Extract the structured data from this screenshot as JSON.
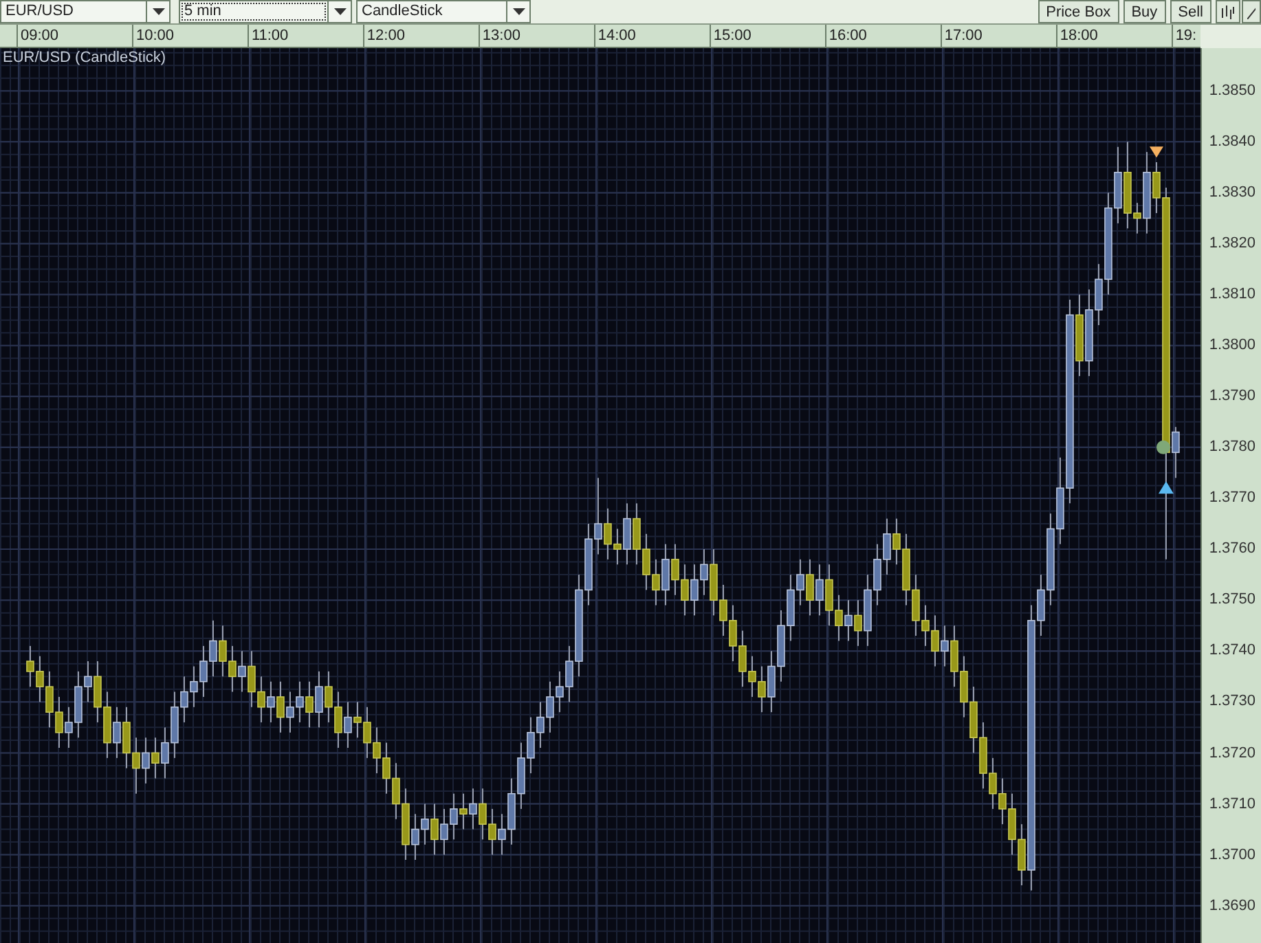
{
  "toolbar": {
    "symbol": "EUR/USD",
    "timeframe": "5 min",
    "chart_type": "CandleStick",
    "buttons": [
      "Price Box",
      "Buy",
      "Sell"
    ]
  },
  "chart": {
    "chart_data": {
      "type": "candlestick",
      "title": "EUR/USD (CandleStick)",
      "grid": true,
      "xlim": [
        8.655,
        19.048
      ],
      "ylim": [
        1.36824,
        1.38584
      ],
      "x": [
        8.9167,
        9,
        9.0833,
        9.1667,
        9.25,
        9.3333,
        9.4167,
        9.5,
        9.5833,
        9.6667,
        9.75,
        9.8333,
        9.9167,
        10,
        10.0833,
        10.1667,
        10.25,
        10.3333,
        10.4167,
        10.5,
        10.5833,
        10.6667,
        10.75,
        10.8333,
        10.9167,
        11,
        11.0833,
        11.1667,
        11.25,
        11.3333,
        11.4167,
        11.5,
        11.5833,
        11.6667,
        11.75,
        11.8333,
        11.9167,
        12,
        12.0833,
        12.1667,
        12.25,
        12.3333,
        12.4167,
        12.5,
        12.5833,
        12.6667,
        12.75,
        12.8333,
        12.9167,
        13,
        13.0833,
        13.1667,
        13.25,
        13.3333,
        13.4167,
        13.5,
        13.5833,
        13.6667,
        13.75,
        13.8333,
        13.9167,
        14,
        14.0833,
        14.1667,
        14.25,
        14.3333,
        14.4167,
        14.5,
        14.5833,
        14.6667,
        14.75,
        14.8333,
        14.9167,
        15,
        15.0833,
        15.1667,
        15.25,
        15.3333,
        15.4167,
        15.5,
        15.5833,
        15.6667,
        15.75,
        15.8333,
        15.9167,
        16,
        16.0833,
        16.1667,
        16.25,
        16.3333,
        16.4167,
        16.5,
        16.5833,
        16.6667,
        16.75,
        16.8333,
        16.9167,
        17,
        17.0833,
        17.1667,
        17.25,
        17.3333,
        17.4167,
        17.5,
        17.5833,
        17.6667,
        17.75,
        17.8333,
        17.9167,
        18,
        18.0833,
        18.1667,
        18.25,
        18.3333,
        18.4167,
        18.5,
        18.5833,
        18.6667,
        18.75,
        18.8333
      ],
      "ohlc": [
        [
          1.3738,
          1.3741,
          1.3733,
          1.3736
        ],
        [
          1.3736,
          1.3739,
          1.373,
          1.3733
        ],
        [
          1.3733,
          1.3736,
          1.3725,
          1.3728
        ],
        [
          1.3728,
          1.3731,
          1.3721,
          1.3724
        ],
        [
          1.3724,
          1.3729,
          1.3721,
          1.3726
        ],
        [
          1.3726,
          1.3736,
          1.3723,
          1.3733
        ],
        [
          1.3733,
          1.3738,
          1.373,
          1.3735
        ],
        [
          1.3735,
          1.3738,
          1.3726,
          1.3729
        ],
        [
          1.3729,
          1.3732,
          1.3719,
          1.3722
        ],
        [
          1.3722,
          1.3729,
          1.3719,
          1.3726
        ],
        [
          1.3726,
          1.3729,
          1.3717,
          1.372
        ],
        [
          1.372,
          1.3723,
          1.3712,
          1.3717
        ],
        [
          1.3717,
          1.3723,
          1.3714,
          1.372
        ],
        [
          1.372,
          1.3723,
          1.3715,
          1.3718
        ],
        [
          1.3718,
          1.3725,
          1.3715,
          1.3722
        ],
        [
          1.3722,
          1.3732,
          1.3719,
          1.3729
        ],
        [
          1.3729,
          1.3735,
          1.3726,
          1.3732
        ],
        [
          1.3732,
          1.3737,
          1.3729,
          1.3734
        ],
        [
          1.3734,
          1.3741,
          1.3731,
          1.3738
        ],
        [
          1.3738,
          1.3746,
          1.3735,
          1.3742
        ],
        [
          1.3742,
          1.3745,
          1.3735,
          1.3738
        ],
        [
          1.3738,
          1.3741,
          1.3732,
          1.3735
        ],
        [
          1.3735,
          1.374,
          1.3732,
          1.3737
        ],
        [
          1.3737,
          1.374,
          1.3729,
          1.3732
        ],
        [
          1.3732,
          1.3735,
          1.3726,
          1.3729
        ],
        [
          1.3729,
          1.3734,
          1.3726,
          1.3731
        ],
        [
          1.3731,
          1.3734,
          1.3724,
          1.3727
        ],
        [
          1.3727,
          1.3732,
          1.3724,
          1.3729
        ],
        [
          1.3729,
          1.3734,
          1.3726,
          1.3731
        ],
        [
          1.3731,
          1.3734,
          1.3725,
          1.3728
        ],
        [
          1.3728,
          1.3736,
          1.3725,
          1.3733
        ],
        [
          1.3733,
          1.3736,
          1.3726,
          1.3729
        ],
        [
          1.3729,
          1.3732,
          1.3721,
          1.3724
        ],
        [
          1.3724,
          1.373,
          1.3721,
          1.3727
        ],
        [
          1.3727,
          1.373,
          1.3723,
          1.3726
        ],
        [
          1.3726,
          1.3729,
          1.3719,
          1.3722
        ],
        [
          1.3722,
          1.3725,
          1.3716,
          1.3719
        ],
        [
          1.3719,
          1.3722,
          1.3712,
          1.3715
        ],
        [
          1.3715,
          1.3718,
          1.3707,
          1.371
        ],
        [
          1.371,
          1.3713,
          1.3699,
          1.3702
        ],
        [
          1.3702,
          1.3708,
          1.3699,
          1.3705
        ],
        [
          1.3705,
          1.371,
          1.3702,
          1.3707
        ],
        [
          1.3707,
          1.371,
          1.37,
          1.3703
        ],
        [
          1.3703,
          1.3709,
          1.37,
          1.3706
        ],
        [
          1.3706,
          1.3712,
          1.3703,
          1.3709
        ],
        [
          1.3709,
          1.3712,
          1.3705,
          1.3708
        ],
        [
          1.3708,
          1.3713,
          1.3705,
          1.371
        ],
        [
          1.371,
          1.3713,
          1.3703,
          1.3706
        ],
        [
          1.3706,
          1.3709,
          1.37,
          1.3703
        ],
        [
          1.3703,
          1.3708,
          1.37,
          1.3705
        ],
        [
          1.3705,
          1.3715,
          1.3702,
          1.3712
        ],
        [
          1.3712,
          1.3722,
          1.3709,
          1.3719
        ],
        [
          1.3719,
          1.3727,
          1.3716,
          1.3724
        ],
        [
          1.3724,
          1.373,
          1.3721,
          1.3727
        ],
        [
          1.3727,
          1.3734,
          1.3724,
          1.3731
        ],
        [
          1.3731,
          1.3736,
          1.3728,
          1.3733
        ],
        [
          1.3733,
          1.3741,
          1.373,
          1.3738
        ],
        [
          1.3738,
          1.3755,
          1.3735,
          1.3752
        ],
        [
          1.3752,
          1.3765,
          1.3749,
          1.3762
        ],
        [
          1.3762,
          1.3774,
          1.3759,
          1.3765
        ],
        [
          1.3765,
          1.3768,
          1.3758,
          1.3761
        ],
        [
          1.3761,
          1.3764,
          1.3757,
          1.376
        ],
        [
          1.376,
          1.3769,
          1.3757,
          1.3766
        ],
        [
          1.3766,
          1.3769,
          1.3757,
          1.376
        ],
        [
          1.376,
          1.3763,
          1.3752,
          1.3755
        ],
        [
          1.3755,
          1.3758,
          1.3749,
          1.3752
        ],
        [
          1.3752,
          1.3761,
          1.3749,
          1.3758
        ],
        [
          1.3758,
          1.3761,
          1.3751,
          1.3754
        ],
        [
          1.3754,
          1.3757,
          1.3747,
          1.375
        ],
        [
          1.375,
          1.3757,
          1.3747,
          1.3754
        ],
        [
          1.3754,
          1.376,
          1.3751,
          1.3757
        ],
        [
          1.3757,
          1.376,
          1.3747,
          1.375
        ],
        [
          1.375,
          1.3753,
          1.3743,
          1.3746
        ],
        [
          1.3746,
          1.3749,
          1.3738,
          1.3741
        ],
        [
          1.3741,
          1.3744,
          1.3733,
          1.3736
        ],
        [
          1.3736,
          1.3739,
          1.3731,
          1.3734
        ],
        [
          1.3734,
          1.3737,
          1.3728,
          1.3731
        ],
        [
          1.3731,
          1.374,
          1.3728,
          1.3737
        ],
        [
          1.3737,
          1.3748,
          1.3734,
          1.3745
        ],
        [
          1.3745,
          1.3755,
          1.3742,
          1.3752
        ],
        [
          1.3752,
          1.3758,
          1.3749,
          1.3755
        ],
        [
          1.3755,
          1.3758,
          1.3747,
          1.375
        ],
        [
          1.375,
          1.3757,
          1.3747,
          1.3754
        ],
        [
          1.3754,
          1.3757,
          1.3745,
          1.3748
        ],
        [
          1.3748,
          1.3751,
          1.3742,
          1.3745
        ],
        [
          1.3745,
          1.375,
          1.3742,
          1.3747
        ],
        [
          1.3747,
          1.375,
          1.3741,
          1.3744
        ],
        [
          1.3744,
          1.3755,
          1.3741,
          1.3752
        ],
        [
          1.3752,
          1.3761,
          1.3749,
          1.3758
        ],
        [
          1.3758,
          1.3766,
          1.3755,
          1.3763
        ],
        [
          1.3763,
          1.3766,
          1.3757,
          1.376
        ],
        [
          1.376,
          1.3763,
          1.3749,
          1.3752
        ],
        [
          1.3752,
          1.3755,
          1.3743,
          1.3746
        ],
        [
          1.3746,
          1.3749,
          1.3741,
          1.3744
        ],
        [
          1.3744,
          1.3747,
          1.3737,
          1.374
        ],
        [
          1.374,
          1.3745,
          1.3737,
          1.3742
        ],
        [
          1.3742,
          1.3745,
          1.3733,
          1.3736
        ],
        [
          1.3736,
          1.3739,
          1.3727,
          1.373
        ],
        [
          1.373,
          1.3733,
          1.372,
          1.3723
        ],
        [
          1.3723,
          1.3726,
          1.3713,
          1.3716
        ],
        [
          1.3716,
          1.3719,
          1.3709,
          1.3712
        ],
        [
          1.3712,
          1.3715,
          1.3706,
          1.3709
        ],
        [
          1.3709,
          1.3712,
          1.37,
          1.3703
        ],
        [
          1.3703,
          1.3706,
          1.3694,
          1.3697
        ],
        [
          1.3697,
          1.3749,
          1.3693,
          1.3746
        ],
        [
          1.3746,
          1.3755,
          1.3743,
          1.3752
        ],
        [
          1.3752,
          1.3767,
          1.3749,
          1.3764
        ],
        [
          1.3764,
          1.3778,
          1.3761,
          1.3772
        ],
        [
          1.3772,
          1.3809,
          1.3769,
          1.3806
        ],
        [
          1.3806,
          1.381,
          1.3794,
          1.3797
        ],
        [
          1.3797,
          1.3811,
          1.3794,
          1.3807
        ],
        [
          1.3807,
          1.3816,
          1.3804,
          1.3813
        ],
        [
          1.3813,
          1.383,
          1.381,
          1.3827
        ],
        [
          1.3827,
          1.3839,
          1.3824,
          1.3834
        ],
        [
          1.3834,
          1.384,
          1.3823,
          1.3826
        ],
        [
          1.3826,
          1.3828,
          1.3822,
          1.3825
        ],
        [
          1.3825,
          1.3838,
          1.3822,
          1.3834
        ],
        [
          1.3834,
          1.3836,
          1.3826,
          1.3829
        ],
        [
          1.3829,
          1.3831,
          1.3758,
          1.3779
        ],
        [
          1.3779,
          1.3784,
          1.3774,
          1.3783
        ]
      ],
      "xticks": [
        {
          "value": 9,
          "label": "09:00"
        },
        {
          "value": 10,
          "label": "10:00"
        },
        {
          "value": 11,
          "label": "11:00"
        },
        {
          "value": 12,
          "label": "12:00"
        },
        {
          "value": 13,
          "label": "13:00"
        },
        {
          "value": 14,
          "label": "14:00"
        },
        {
          "value": 15,
          "label": "15:00"
        },
        {
          "value": 16,
          "label": "16:00"
        },
        {
          "value": 17,
          "label": "17:00"
        },
        {
          "value": 18,
          "label": "18:00"
        },
        {
          "value": 19,
          "label": "19:"
        }
      ],
      "yticks": [
        {
          "value": 1.385,
          "label": "1.3850"
        },
        {
          "value": 1.384,
          "label": "1.3840"
        },
        {
          "value": 1.383,
          "label": "1.3830"
        },
        {
          "value": 1.382,
          "label": "1.3820"
        },
        {
          "value": 1.381,
          "label": "1.3810"
        },
        {
          "value": 1.38,
          "label": "1.3800"
        },
        {
          "value": 1.379,
          "label": "1.3790"
        },
        {
          "value": 1.378,
          "label": "1.3780"
        },
        {
          "value": 1.377,
          "label": "1.3770"
        },
        {
          "value": 1.376,
          "label": "1.3760"
        },
        {
          "value": 1.375,
          "label": "1.3750"
        },
        {
          "value": 1.374,
          "label": "1.3740"
        },
        {
          "value": 1.373,
          "label": "1.3730"
        },
        {
          "value": 1.372,
          "label": "1.3720"
        },
        {
          "value": 1.371,
          "label": "1.3710"
        },
        {
          "value": 1.37,
          "label": "1.3700"
        },
        {
          "value": 1.369,
          "label": "1.3690"
        }
      ]
    }
  }
}
